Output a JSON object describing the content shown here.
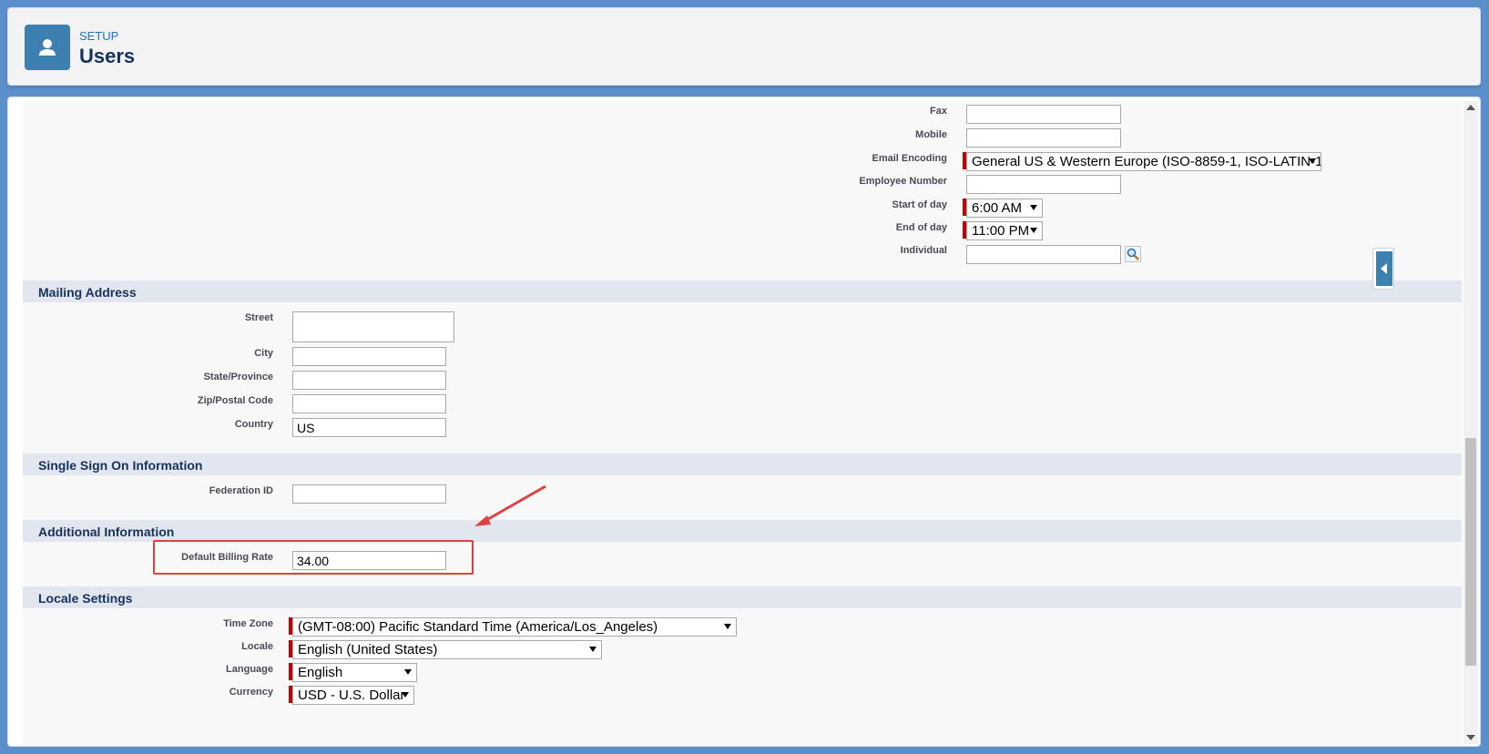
{
  "header": {
    "eyebrow": "SETUP",
    "title": "Users",
    "icon": "user-icon"
  },
  "top_fields": [
    {
      "label": "Fax",
      "value": ""
    },
    {
      "label": "Mobile",
      "value": ""
    },
    {
      "label": "Email Encoding",
      "value": "General US & Western Europe (ISO-8859-1, ISO-LATIN-1)",
      "required": true
    },
    {
      "label": "Employee Number",
      "value": ""
    },
    {
      "label": "Start of day",
      "value": "6:00 AM",
      "required": true
    },
    {
      "label": "End of day",
      "value": "11:00 PM",
      "required": true
    },
    {
      "label": "Individual",
      "value": ""
    }
  ],
  "mailing_address": {
    "title": "Mailing Address",
    "street_label": "Street",
    "street_value": "",
    "city_label": "City",
    "city_value": "",
    "state_label": "State/Province",
    "state_value": "",
    "zip_label": "Zip/Postal Code",
    "zip_value": "",
    "country_label": "Country",
    "country_value": "US"
  },
  "sso": {
    "title": "Single Sign On Information",
    "federation_label": "Federation ID",
    "federation_value": ""
  },
  "additional": {
    "title": "Additional Information",
    "billing_label": "Default Billing Rate",
    "billing_value": "34.00"
  },
  "locale": {
    "title": "Locale Settings",
    "timezone_label": "Time Zone",
    "timezone_value": "(GMT-08:00) Pacific Standard Time (America/Los_Angeles)",
    "locale_label": "Locale",
    "locale_value": "English (United States)",
    "language_label": "Language",
    "language_value": "English",
    "currency_label": "Currency",
    "currency_value": "USD - U.S. Dollar"
  },
  "colors": {
    "required_marker": "#cc0000",
    "annotation": "#e04040",
    "brand": "#3c7fb1"
  }
}
